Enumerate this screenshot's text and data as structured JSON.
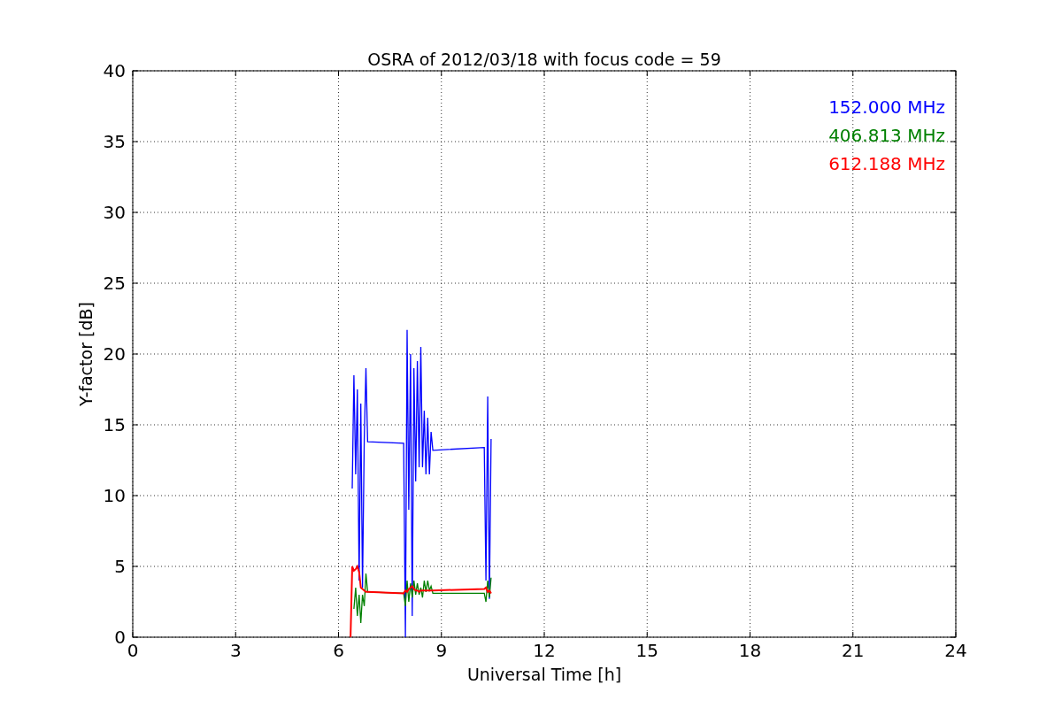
{
  "chart_data": {
    "type": "line",
    "title": "OSRA of 2012/03/18 with focus code = 59",
    "xlabel": "Universal Time [h]",
    "ylabel": "Y-factor [dB]",
    "x": [
      6.35,
      6.4,
      6.45,
      6.5,
      6.55,
      6.6,
      6.65,
      6.7,
      6.75,
      6.8,
      6.85,
      7.9,
      7.95,
      8.0,
      8.05,
      8.1,
      8.15,
      8.2,
      8.25,
      8.3,
      8.35,
      8.4,
      8.45,
      8.5,
      8.55,
      8.6,
      8.65,
      8.7,
      8.75,
      10.25,
      10.3,
      10.35,
      10.4,
      10.45
    ],
    "series": [
      {
        "name": "152.000 MHz",
        "color": "#0000ff",
        "values": [
          null,
          10.5,
          18.5,
          11.5,
          17.5,
          4,
          16.5,
          3.5,
          14,
          19,
          13.8,
          13.7,
          0,
          21.7,
          9,
          20,
          1.5,
          19,
          11,
          19.5,
          12,
          20.5,
          12,
          16,
          11.5,
          15.5,
          11.5,
          14.5,
          13.2,
          13.4,
          4,
          17,
          2.7,
          14
        ]
      },
      {
        "name": "406.813 MHz",
        "color": "#008000",
        "values": [
          null,
          null,
          2,
          3.5,
          1.5,
          3,
          1,
          3,
          2.2,
          4.5,
          3.2,
          3.1,
          2.2,
          4,
          2.5,
          3.8,
          2.8,
          4,
          3,
          3.8,
          3,
          3.5,
          2.8,
          4,
          3.2,
          4,
          3.3,
          3.6,
          3.1,
          3.1,
          2.5,
          4,
          2.8,
          4.2
        ]
      },
      {
        "name": "612.188 MHz",
        "color": "#ff0000",
        "values": [
          0,
          5,
          4.7,
          4.8,
          5,
          4.6,
          3.5,
          3.4,
          3.3,
          3.2,
          3.2,
          3.1,
          3.3,
          3.2,
          3.4,
          3.5,
          3.6,
          3.4,
          3.3,
          3.3,
          3.2,
          3.3,
          3.3,
          3.3,
          3.3,
          3.3,
          3.3,
          3.3,
          3.3,
          3.4,
          3.5,
          3.2,
          3.3,
          3.1
        ]
      }
    ],
    "grid": true,
    "xlim": [
      0,
      24
    ],
    "ylim": [
      0,
      40
    ],
    "xticks": [
      0,
      3,
      6,
      9,
      12,
      15,
      18,
      21,
      24
    ],
    "yticks": [
      0,
      5,
      10,
      15,
      20,
      25,
      30,
      35,
      40
    ]
  }
}
